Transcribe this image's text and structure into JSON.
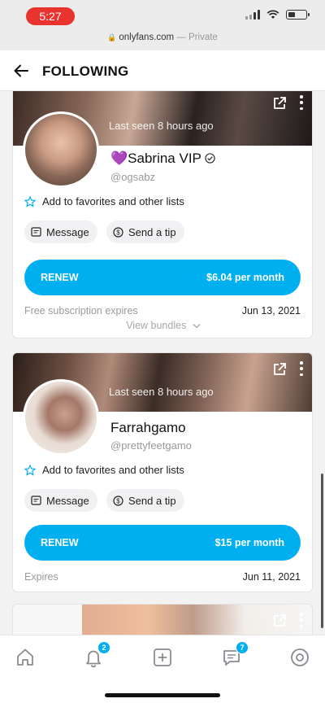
{
  "status_bar": {
    "time": "5:27"
  },
  "browser": {
    "url": "onlyfans.com",
    "separator": " — ",
    "mode": "Private"
  },
  "header": {
    "title": "FOLLOWING"
  },
  "cards": [
    {
      "last_seen": "Last seen 8 hours ago",
      "name": "💜Sabrina VIP",
      "handle": "@ogsabz",
      "favorites_label": "Add to favorites and other lists",
      "message_label": "Message",
      "tip_label": "Send a tip",
      "renew_label": "RENEW",
      "price_label": "$6.04 per month",
      "expire_label": "Free subscription expires",
      "expire_date": "Jun 13, 2021",
      "bundles_label": "View bundles"
    },
    {
      "last_seen": "Last seen 8 hours ago",
      "name": "Farrahgamo",
      "handle": "@prettyfeetgamo",
      "favorites_label": "Add to favorites and other lists",
      "message_label": "Message",
      "tip_label": "Send a tip",
      "renew_label": "RENEW",
      "price_label": "$15 per month",
      "expire_label": "Expires",
      "expire_date": "Jun 11, 2021"
    }
  ],
  "bottom_nav": {
    "items": [
      "home-icon",
      "bell-icon",
      "plus-square-icon",
      "chat-icon",
      "profile-icon"
    ],
    "notifications_count": "2",
    "messages_count": "7"
  },
  "colors": {
    "accent": "#00aff0",
    "time_pill": "#e8332f"
  }
}
